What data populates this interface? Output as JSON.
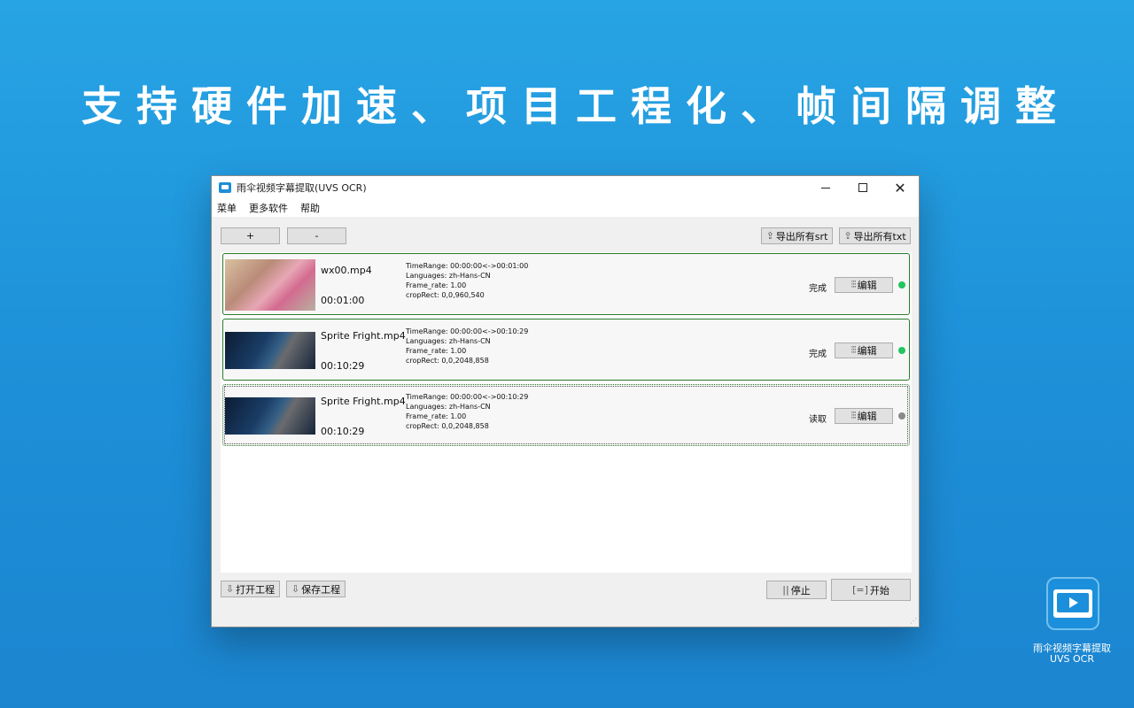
{
  "headline": "支持硬件加速、项目工程化、帧间隔调整",
  "window": {
    "title": "雨伞视频字幕提取(UVS OCR)",
    "controls": {
      "minimize": "—",
      "maximize": "☐",
      "close": "✕"
    }
  },
  "menu": [
    "菜单",
    "更多软件",
    "帮助"
  ],
  "toolbar": {
    "add_label": "+",
    "remove_label": "-",
    "export_srt_label": "导出所有srt",
    "export_txt_label": "导出所有txt"
  },
  "items": [
    {
      "filename": "wx00.mp4",
      "duration": "00:01:00",
      "time_range": "TimeRange: 00:00:00<->00:01:00",
      "languages": "Languages: zh-Hans-CN",
      "frame_rate": "Frame_rate: 1.00",
      "crop_rect": "cropRect: 0,0,960,540",
      "status": "完成",
      "edit_label": "编辑",
      "dot_color": "#22c55e"
    },
    {
      "filename": "Sprite Fright.mp4",
      "duration": "00:10:29",
      "time_range": "TimeRange: 00:00:00<->00:10:29",
      "languages": "Languages: zh-Hans-CN",
      "frame_rate": "Frame_rate: 1.00",
      "crop_rect": "cropRect: 0,0,2048,858",
      "status": "完成",
      "edit_label": "编辑",
      "dot_color": "#22c55e"
    },
    {
      "filename": "Sprite Fright.mp4",
      "duration": "00:10:29",
      "time_range": "TimeRange: 00:00:00<->00:10:29",
      "languages": "Languages: zh-Hans-CN",
      "frame_rate": "Frame_rate: 1.00",
      "crop_rect": "cropRect: 0,0,2048,858",
      "status": "读取",
      "edit_label": "编辑",
      "dot_color": "#8a8a8a"
    }
  ],
  "bottom": {
    "open_project_label": "打开工程",
    "save_project_label": "保存工程",
    "stop_label": "停止",
    "start_label": "开始"
  },
  "brand": {
    "name": "雨伞视频字幕提取",
    "sub": "UVS OCR",
    "color": "#1b8fdb"
  },
  "icons": {
    "export": "export-icon",
    "edit": "sliders-icon",
    "stop": "pause-icon",
    "start": "scan-icon"
  }
}
